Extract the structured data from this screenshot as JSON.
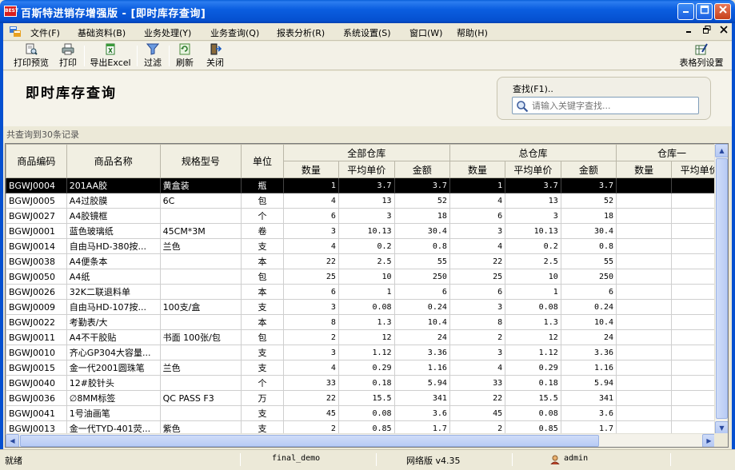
{
  "window": {
    "logo_text": "BEST",
    "title": "百斯特进销存增强版 - [即时库存查询]"
  },
  "menu": [
    {
      "label": "文件(F)"
    },
    {
      "label": "基础资料(B)"
    },
    {
      "label": "业务处理(Y)"
    },
    {
      "label": "业务查询(Q)"
    },
    {
      "label": "报表分析(R)"
    },
    {
      "label": "系统设置(S)"
    },
    {
      "label": "窗口(W)"
    },
    {
      "label": "帮助(H)"
    }
  ],
  "toolbar": {
    "print_preview": "打印预览",
    "print": "打印",
    "export_excel": "导出Excel",
    "filter": "过滤",
    "refresh": "刷新",
    "close": "关闭",
    "column_settings": "表格列设置"
  },
  "page": {
    "title": "即时库存查询",
    "search_label": "查找(F1)..",
    "search_placeholder": "请输入关键字查找...",
    "record_count": "共查询到30条记录"
  },
  "grid": {
    "headers": {
      "code": "商品编码",
      "name": "商品名称",
      "spec": "规格型号",
      "unit": "单位",
      "group_all": "全部仓库",
      "group_main": "总仓库",
      "group_wh1": "仓库一",
      "qty": "数量",
      "avg_price": "平均单价",
      "amount": "金额"
    },
    "rows": [
      {
        "code": "BGWJ0004",
        "name": "201AA胶",
        "spec": "黄盒装",
        "unit": "瓶",
        "a_qty": "1",
        "a_price": "3.7",
        "a_amt": "3.7",
        "m_qty": "1",
        "m_price": "3.7",
        "m_amt": "3.7"
      },
      {
        "code": "BGWJ0005",
        "name": "A4过胶膜",
        "spec": "6C",
        "unit": "包",
        "a_qty": "4",
        "a_price": "13",
        "a_amt": "52",
        "m_qty": "4",
        "m_price": "13",
        "m_amt": "52"
      },
      {
        "code": "BGWJ0027",
        "name": "A4胶镜框",
        "spec": "",
        "unit": "个",
        "a_qty": "6",
        "a_price": "3",
        "a_amt": "18",
        "m_qty": "6",
        "m_price": "3",
        "m_amt": "18"
      },
      {
        "code": "BGWJ0001",
        "name": "蓝色玻璃纸",
        "spec": "45CM*3M",
        "unit": "卷",
        "a_qty": "3",
        "a_price": "10.13",
        "a_amt": "30.4",
        "m_qty": "3",
        "m_price": "10.13",
        "m_amt": "30.4"
      },
      {
        "code": "BGWJ0014",
        "name": "自由马HD-380按...",
        "spec": "兰色",
        "unit": "支",
        "a_qty": "4",
        "a_price": "0.2",
        "a_amt": "0.8",
        "m_qty": "4",
        "m_price": "0.2",
        "m_amt": "0.8"
      },
      {
        "code": "BGWJ0038",
        "name": "A4便条本",
        "spec": "",
        "unit": "本",
        "a_qty": "22",
        "a_price": "2.5",
        "a_amt": "55",
        "m_qty": "22",
        "m_price": "2.5",
        "m_amt": "55"
      },
      {
        "code": "BGWJ0050",
        "name": "A4纸",
        "spec": "",
        "unit": "包",
        "a_qty": "25",
        "a_price": "10",
        "a_amt": "250",
        "m_qty": "25",
        "m_price": "10",
        "m_amt": "250"
      },
      {
        "code": "BGWJ0026",
        "name": "32K二联退料单",
        "spec": "",
        "unit": "本",
        "a_qty": "6",
        "a_price": "1",
        "a_amt": "6",
        "m_qty": "6",
        "m_price": "1",
        "m_amt": "6"
      },
      {
        "code": "BGWJ0009",
        "name": "自由马HD-107按...",
        "spec": "100支/盒",
        "unit": "支",
        "a_qty": "3",
        "a_price": "0.08",
        "a_amt": "0.24",
        "m_qty": "3",
        "m_price": "0.08",
        "m_amt": "0.24"
      },
      {
        "code": "BGWJ0022",
        "name": "考勤表/大",
        "spec": "",
        "unit": "本",
        "a_qty": "8",
        "a_price": "1.3",
        "a_amt": "10.4",
        "m_qty": "8",
        "m_price": "1.3",
        "m_amt": "10.4"
      },
      {
        "code": "BGWJ0011",
        "name": "A4不干胶贴",
        "spec": "书面 100张/包",
        "unit": "包",
        "a_qty": "2",
        "a_price": "12",
        "a_amt": "24",
        "m_qty": "2",
        "m_price": "12",
        "m_amt": "24"
      },
      {
        "code": "BGWJ0010",
        "name": "齐心GP304大容量...",
        "spec": "",
        "unit": "支",
        "a_qty": "3",
        "a_price": "1.12",
        "a_amt": "3.36",
        "m_qty": "3",
        "m_price": "1.12",
        "m_amt": "3.36"
      },
      {
        "code": "BGWJ0015",
        "name": "金一代2001圆珠笔",
        "spec": "兰色",
        "unit": "支",
        "a_qty": "4",
        "a_price": "0.29",
        "a_amt": "1.16",
        "m_qty": "4",
        "m_price": "0.29",
        "m_amt": "1.16"
      },
      {
        "code": "BGWJ0040",
        "name": "12#胶针头",
        "spec": "",
        "unit": "个",
        "a_qty": "33",
        "a_price": "0.18",
        "a_amt": "5.94",
        "m_qty": "33",
        "m_price": "0.18",
        "m_amt": "5.94"
      },
      {
        "code": "BGWJ0036",
        "name": "∅8MM标签",
        "spec": "QC PASS F3",
        "unit": "万",
        "a_qty": "22",
        "a_price": "15.5",
        "a_amt": "341",
        "m_qty": "22",
        "m_price": "15.5",
        "m_amt": "341"
      },
      {
        "code": "BGWJ0041",
        "name": "1号油画笔",
        "spec": "",
        "unit": "支",
        "a_qty": "45",
        "a_price": "0.08",
        "a_amt": "3.6",
        "m_qty": "45",
        "m_price": "0.08",
        "m_amt": "3.6"
      },
      {
        "code": "BGWJ0013",
        "name": "金一代TYD-401荧...",
        "spec": "紫色",
        "unit": "支",
        "a_qty": "2",
        "a_price": "0.85",
        "a_amt": "1.7",
        "m_qty": "2",
        "m_price": "0.85",
        "m_amt": "1.7"
      }
    ]
  },
  "status": {
    "ready": "就绪",
    "database": "final_demo",
    "version": "网络版 v4.35",
    "user": "admin"
  }
}
